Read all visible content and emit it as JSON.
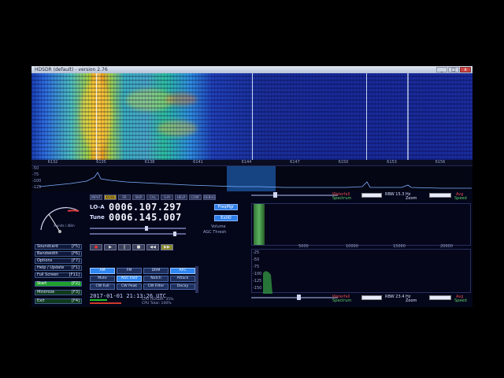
{
  "window": {
    "title": "HDSDR (default) - version 2.76"
  },
  "waterfall": {
    "freq_ticks": [
      "6132",
      "6135",
      "6138",
      "6141",
      "6144",
      "6147",
      "6150",
      "6153",
      "6156"
    ]
  },
  "spectrum": {
    "y_labels": [
      "-50",
      "-75",
      "-100",
      "-125"
    ]
  },
  "toolbar": {
    "buttons": [
      "INPUT",
      "ECSS",
      "SR",
      "SKIP",
      "CAL",
      "S-M",
      "HELP",
      "CONF",
      "DEBUG"
    ]
  },
  "lo": {
    "label": "LO-A",
    "value": "0006.107.297",
    "button": "FreqMgr"
  },
  "tune": {
    "label": "Tune",
    "value": "0006.145.007",
    "button": "ExtIO"
  },
  "volume": {
    "label": "Volume",
    "agc_label": "AGC Thresh"
  },
  "smeter": {
    "label": "S units / dBm",
    "scale": [
      "1",
      "3",
      "5",
      "7",
      "9",
      "+20",
      "+40",
      "+60"
    ]
  },
  "side_buttons": [
    {
      "label": "Soundcard",
      "key": "[F5]"
    },
    {
      "label": "Bandwidth",
      "key": "[F6]"
    },
    {
      "label": "Options",
      "key": "[F7]"
    },
    {
      "label": "Help / Update",
      "key": "[F1]"
    },
    {
      "label": "Full Screen",
      "key": "[F11]"
    },
    {
      "label": "Start",
      "key": "[F2]"
    },
    {
      "label": "Minimize",
      "key": "[F3]"
    },
    {
      "label": "Exit",
      "key": "[F4]"
    }
  ],
  "playback": [
    "●",
    "▶",
    "‖",
    "■",
    "◀◀",
    "▶▶"
  ],
  "modes": [
    [
      "AM",
      "FM",
      "DRM",
      "AFC"
    ],
    [
      "Mute",
      "AGC Fast",
      "Notch",
      "Attack"
    ],
    [
      "CW Full",
      "CW Peak",
      "CW Filter",
      "Decay"
    ]
  ],
  "modes_on": [
    "AM",
    "AGC Fast",
    "AFC"
  ],
  "status": {
    "date": "2017-01-01",
    "time": "21:13:26 UTC",
    "cpu_hdsdr": "CPU HDSDR: 35%",
    "cpu_total": "CPU Total: 100%"
  },
  "right_panel": {
    "top": {
      "label_a": "Waterfall",
      "label_b": "Spectrum",
      "rbw": "RBW 15.3 Hz",
      "zoom": "Zoom",
      "avg": "Avg",
      "speed": "Speed"
    },
    "bottom": {
      "label_a": "Waterfall",
      "label_b": "Spectrum",
      "rbw": "RBW 23.4 Hz",
      "zoom": "Zoom",
      "avg": "Avg",
      "speed": "Speed"
    },
    "audio_ticks": [
      "5000",
      "10000",
      "15000",
      "20000"
    ],
    "audio_y": [
      "-25",
      "-50",
      "-75",
      "-100",
      "-125",
      "-150"
    ]
  }
}
